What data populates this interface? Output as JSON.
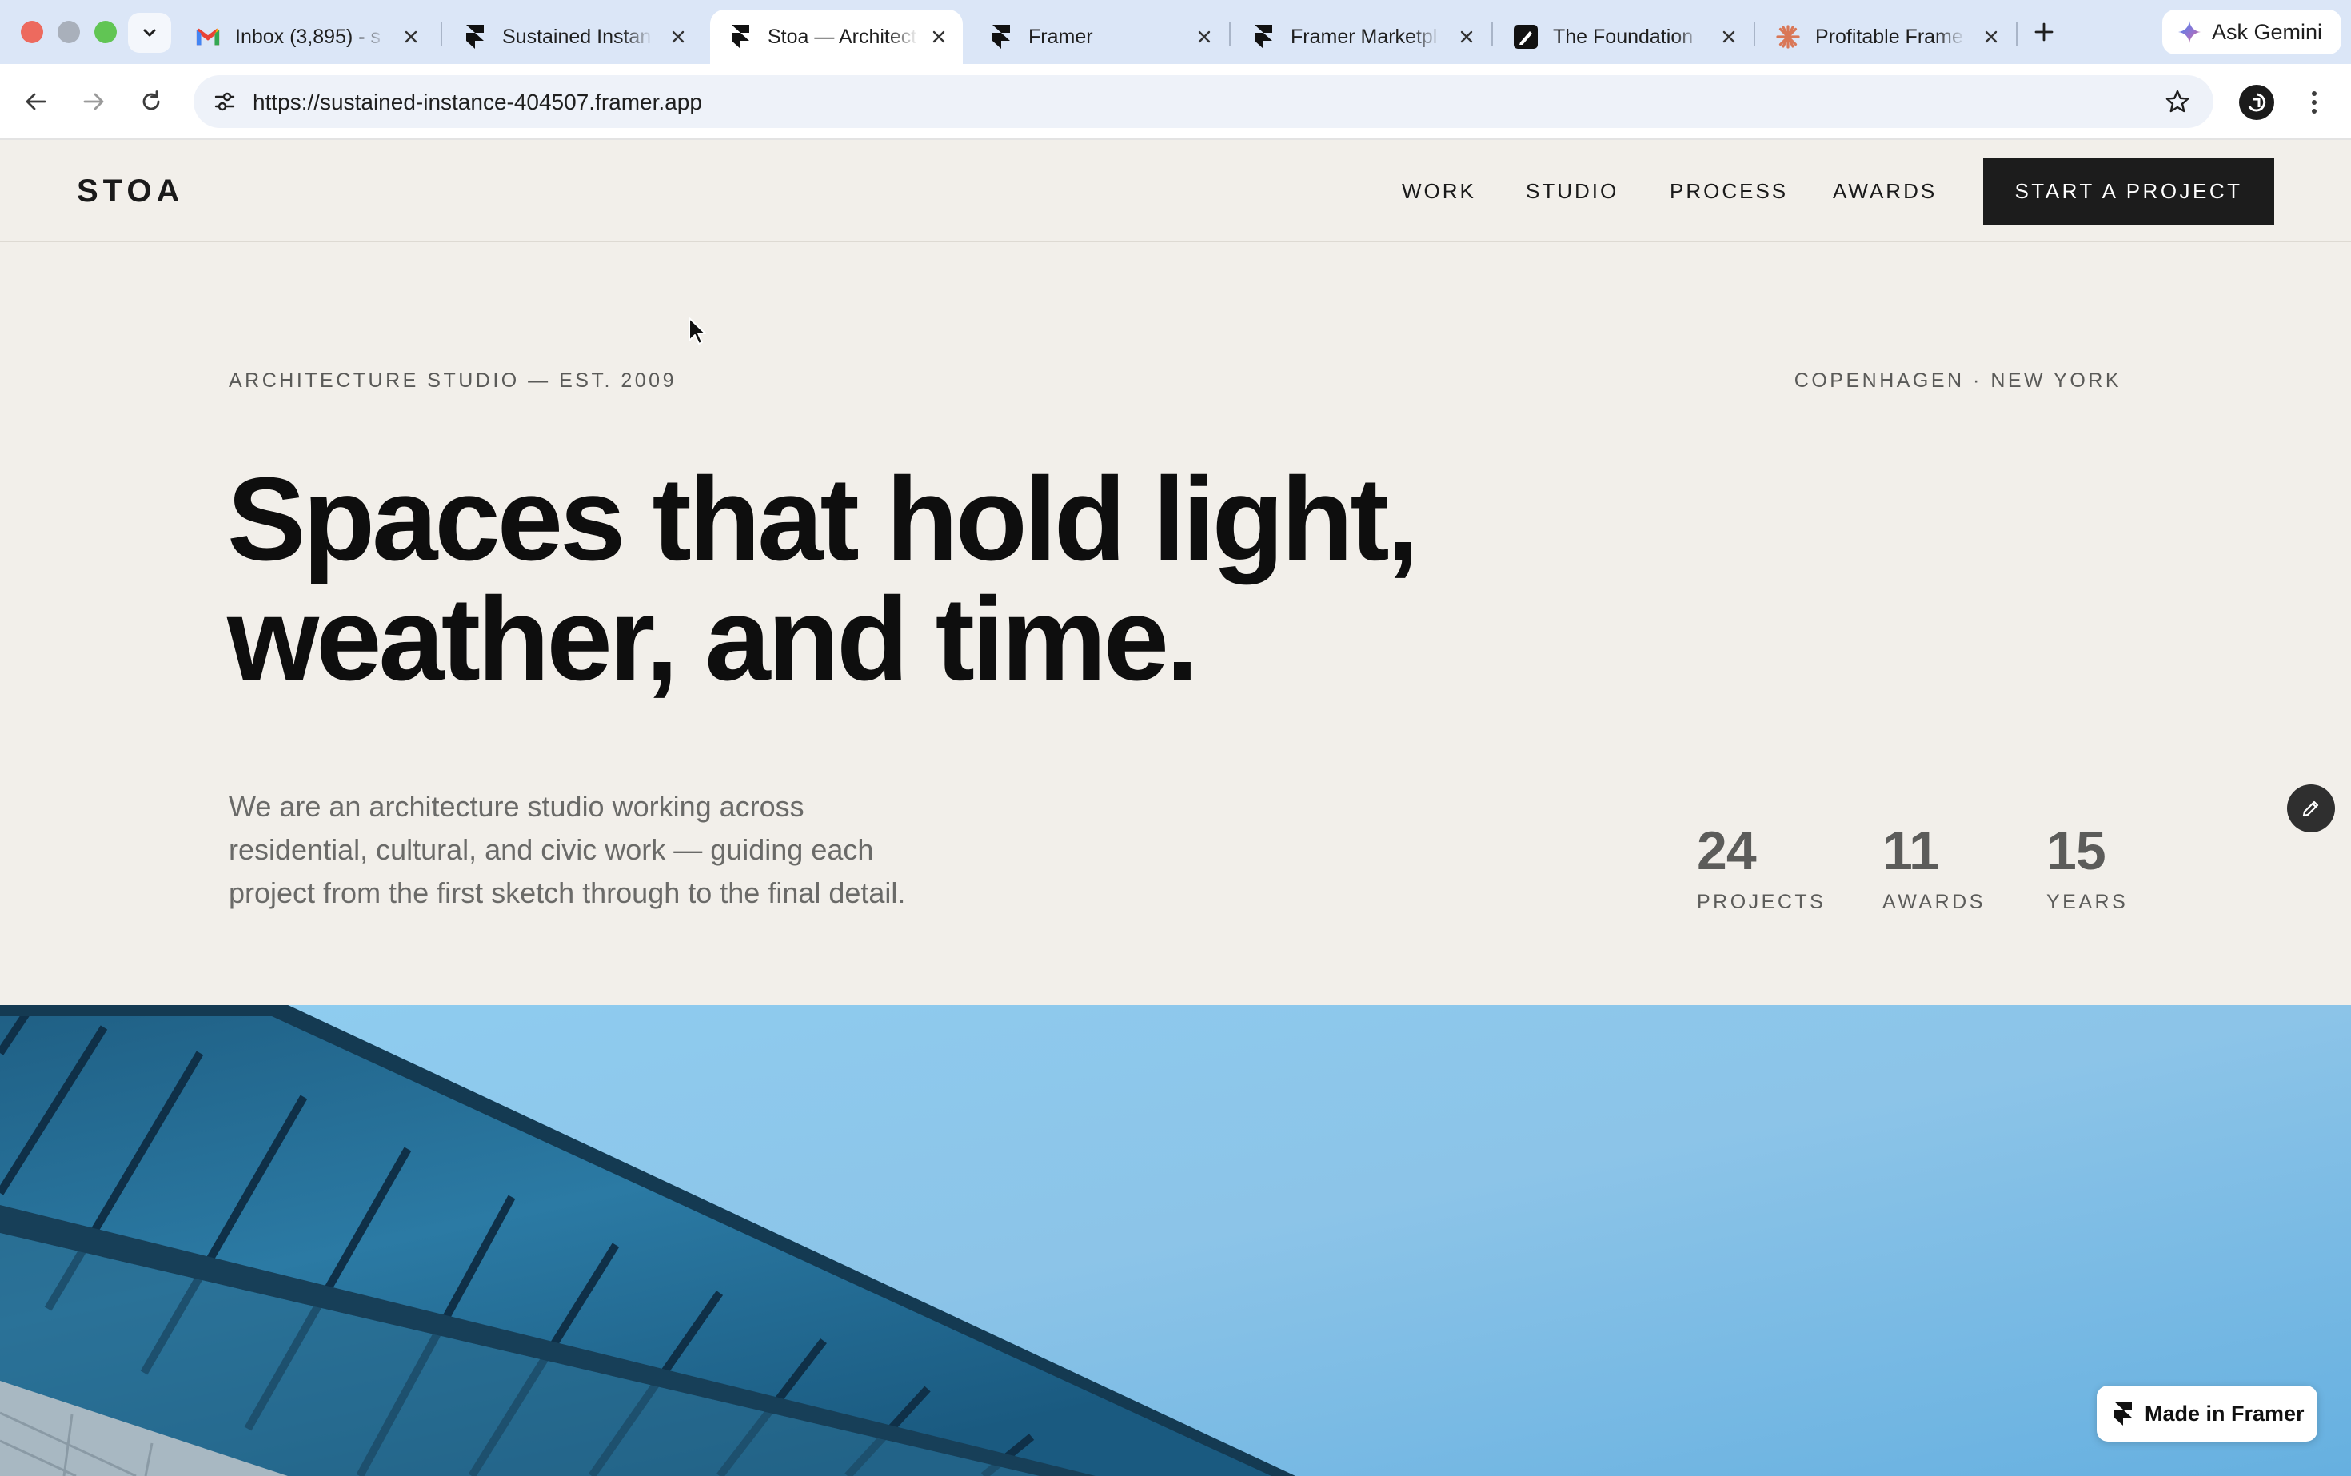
{
  "browser": {
    "tabs": [
      {
        "title": "Inbox (3,895) - s",
        "icon": "gmail-icon",
        "active": false
      },
      {
        "title": "Sustained Instan",
        "icon": "framer-icon",
        "active": false
      },
      {
        "title": "Stoa — Architect",
        "icon": "framer-icon",
        "active": true
      },
      {
        "title": "Framer",
        "icon": "framer-icon",
        "active": false
      },
      {
        "title": "Framer Marketpl",
        "icon": "framer-icon",
        "active": false
      },
      {
        "title": "The Foundation",
        "icon": "foundation-icon",
        "active": false
      },
      {
        "title": "Profitable Frame",
        "icon": "claude-icon",
        "active": false
      }
    ],
    "gemini_label": "Ask Gemini",
    "url": "https://sustained-instance-404507.framer.app"
  },
  "site": {
    "logo": "STOA",
    "nav": [
      "WORK",
      "STUDIO",
      "PROCESS",
      "AWARDS"
    ],
    "cta": "START A PROJECT",
    "eyebrow_left": "ARCHITECTURE STUDIO — EST. 2009",
    "eyebrow_right": "COPENHAGEN · NEW YORK",
    "headline_line1": "Spaces that hold light,",
    "headline_line2": "weather, and time.",
    "intro_line1": "We are an architecture studio working across",
    "intro_line2": "residential, cultural, and civic work — guiding each",
    "intro_line3": "project from the first sketch through to the final detail.",
    "stats": [
      {
        "value": "24",
        "label": "PROJECTS"
      },
      {
        "value": "11",
        "label": "AWARDS"
      },
      {
        "value": "15",
        "label": "YEARS"
      }
    ],
    "badge": "Made in Framer"
  },
  "colors": {
    "page_bg": "#f2efea",
    "ink": "#0e0e0e",
    "cta_bg": "#1c1c1c",
    "sky": "#8cc4e8"
  }
}
